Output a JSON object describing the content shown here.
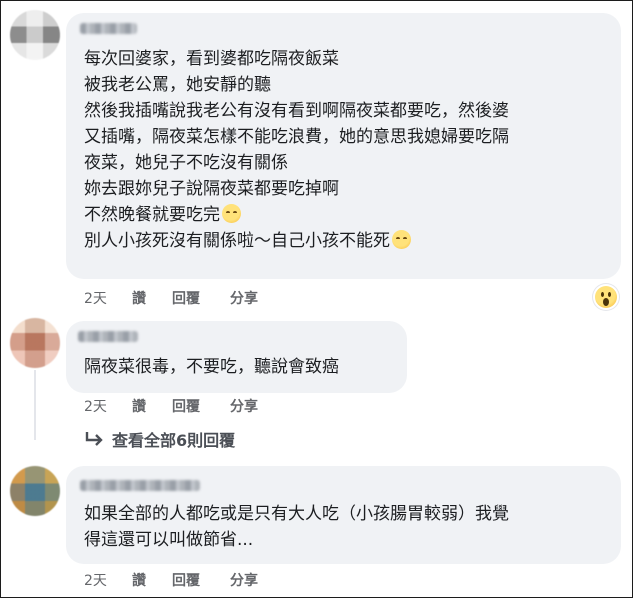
{
  "comments": [
    {
      "lines": [
        "每次回婆家，看到婆都吃隔夜飯菜",
        "被我老公罵，她安靜的聽",
        "然後我插嘴說我老公有沒有看到啊隔夜菜都要吃，然後婆",
        "又插嘴，隔夜菜怎樣不能吃浪費，她的意思我媳婦要吃隔",
        "夜菜，她兒子不吃沒有關係",
        "妳去跟妳兒子說隔夜菜都要吃掉啊",
        "不然晚餐就要吃完",
        "別人小孩死沒有關係啦～自己小孩不能死"
      ],
      "time": "2天",
      "like_label": "讚",
      "reply_label": "回覆",
      "share_label": "分享",
      "reaction_icon": "wow-emoji-icon"
    },
    {
      "lines": [
        "隔夜菜很毒，不要吃，聽說會致癌"
      ],
      "time": "2天",
      "like_label": "讚",
      "reply_label": "回覆",
      "share_label": "分享",
      "view_replies": "查看全部6則回覆"
    },
    {
      "lines": [
        "如果全部的人都吃或是只有大人吃（小孩腸胃較弱）我覺",
        "得這還可以叫做節省..."
      ],
      "time": "2天",
      "like_label": "讚",
      "reply_label": "回覆",
      "share_label": "分享"
    }
  ],
  "colors": {
    "bubble": "#f0f2f5",
    "text": "#1c1e21",
    "meta": "#65676b"
  }
}
